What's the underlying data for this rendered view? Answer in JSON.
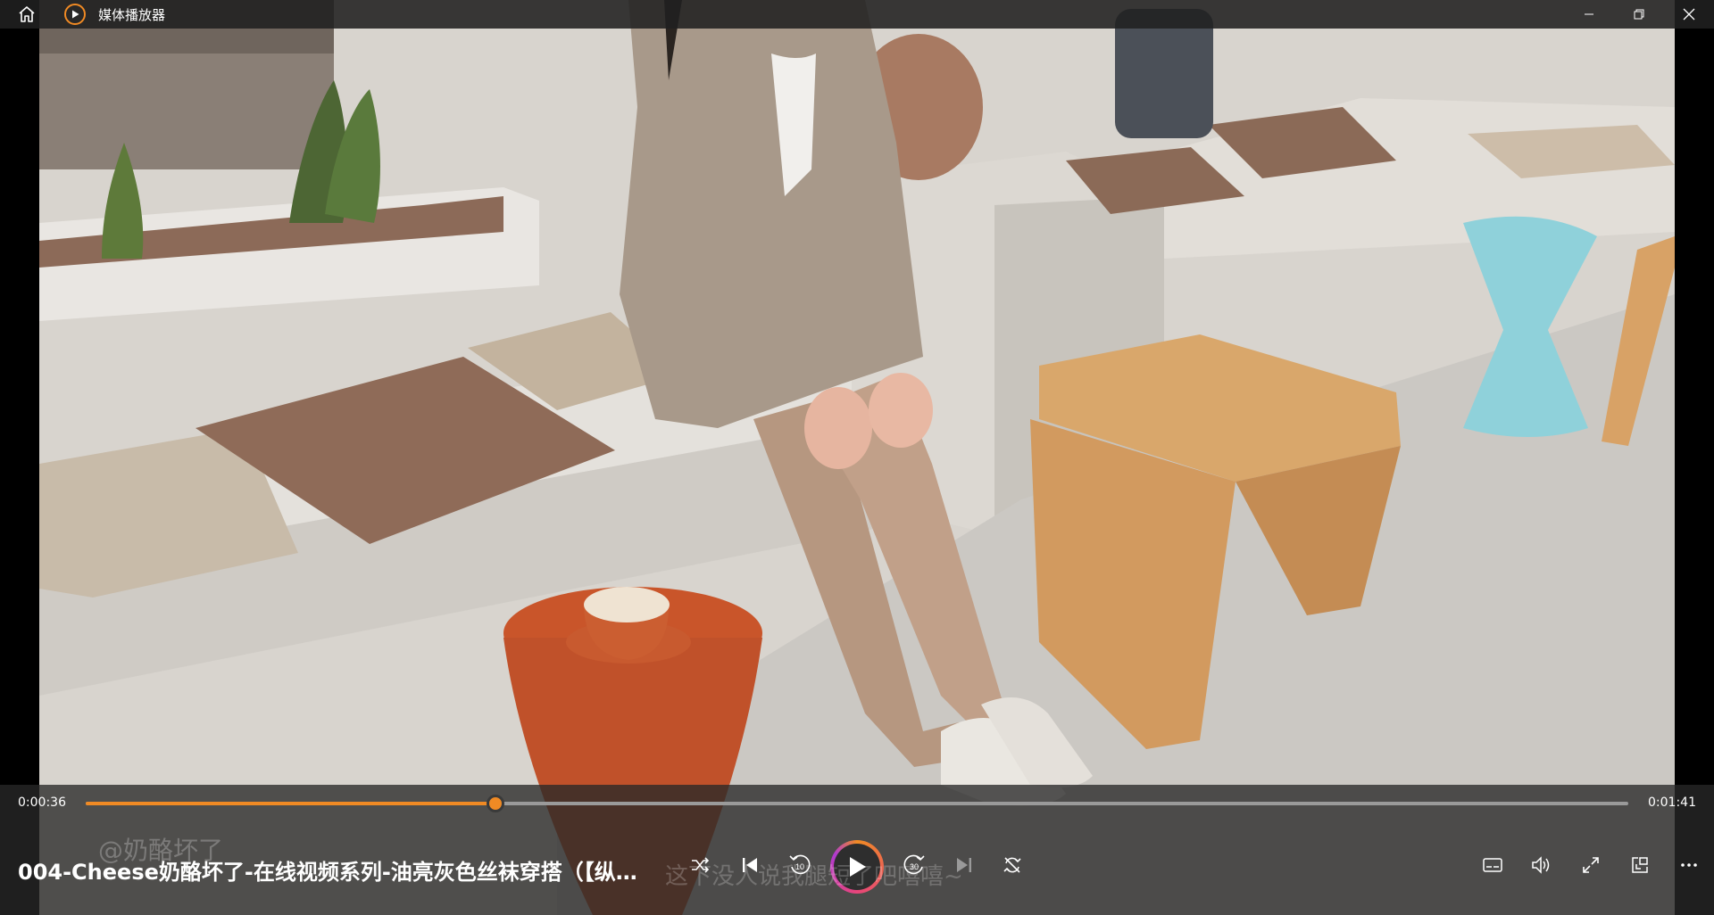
{
  "window": {
    "title": "媒体播放器"
  },
  "player": {
    "current_time": "0:00:36",
    "duration": "0:01:41",
    "progress_fraction": 0.2655,
    "video_title": "004-Cheese奶酪坏了-在线视频系列-油亮灰色丝袜穿搭（【纵…",
    "skip_back_seconds": "10",
    "skip_forward_seconds": "30"
  },
  "overlay_text": {
    "watermark": "@奶酪坏了",
    "subtitle": "这下没人说我腿短了吧嘻嘻~"
  },
  "colors": {
    "accent": "#f08a24",
    "titlebar": "#202020"
  },
  "icons": {
    "home": "home-icon",
    "app": "play-circle-icon",
    "minimize": "minimize-icon",
    "restore": "restore-icon",
    "close": "close-icon",
    "shuffle": "shuffle-icon",
    "previous": "previous-icon",
    "skip_back": "rewind-10-icon",
    "play": "play-icon",
    "skip_forward": "forward-30-icon",
    "next": "next-icon",
    "repeat": "repeat-icon",
    "captions": "captions-icon",
    "volume": "volume-icon",
    "fullscreen": "fullscreen-icon",
    "miniplayer": "miniplayer-icon",
    "more": "more-icon"
  }
}
